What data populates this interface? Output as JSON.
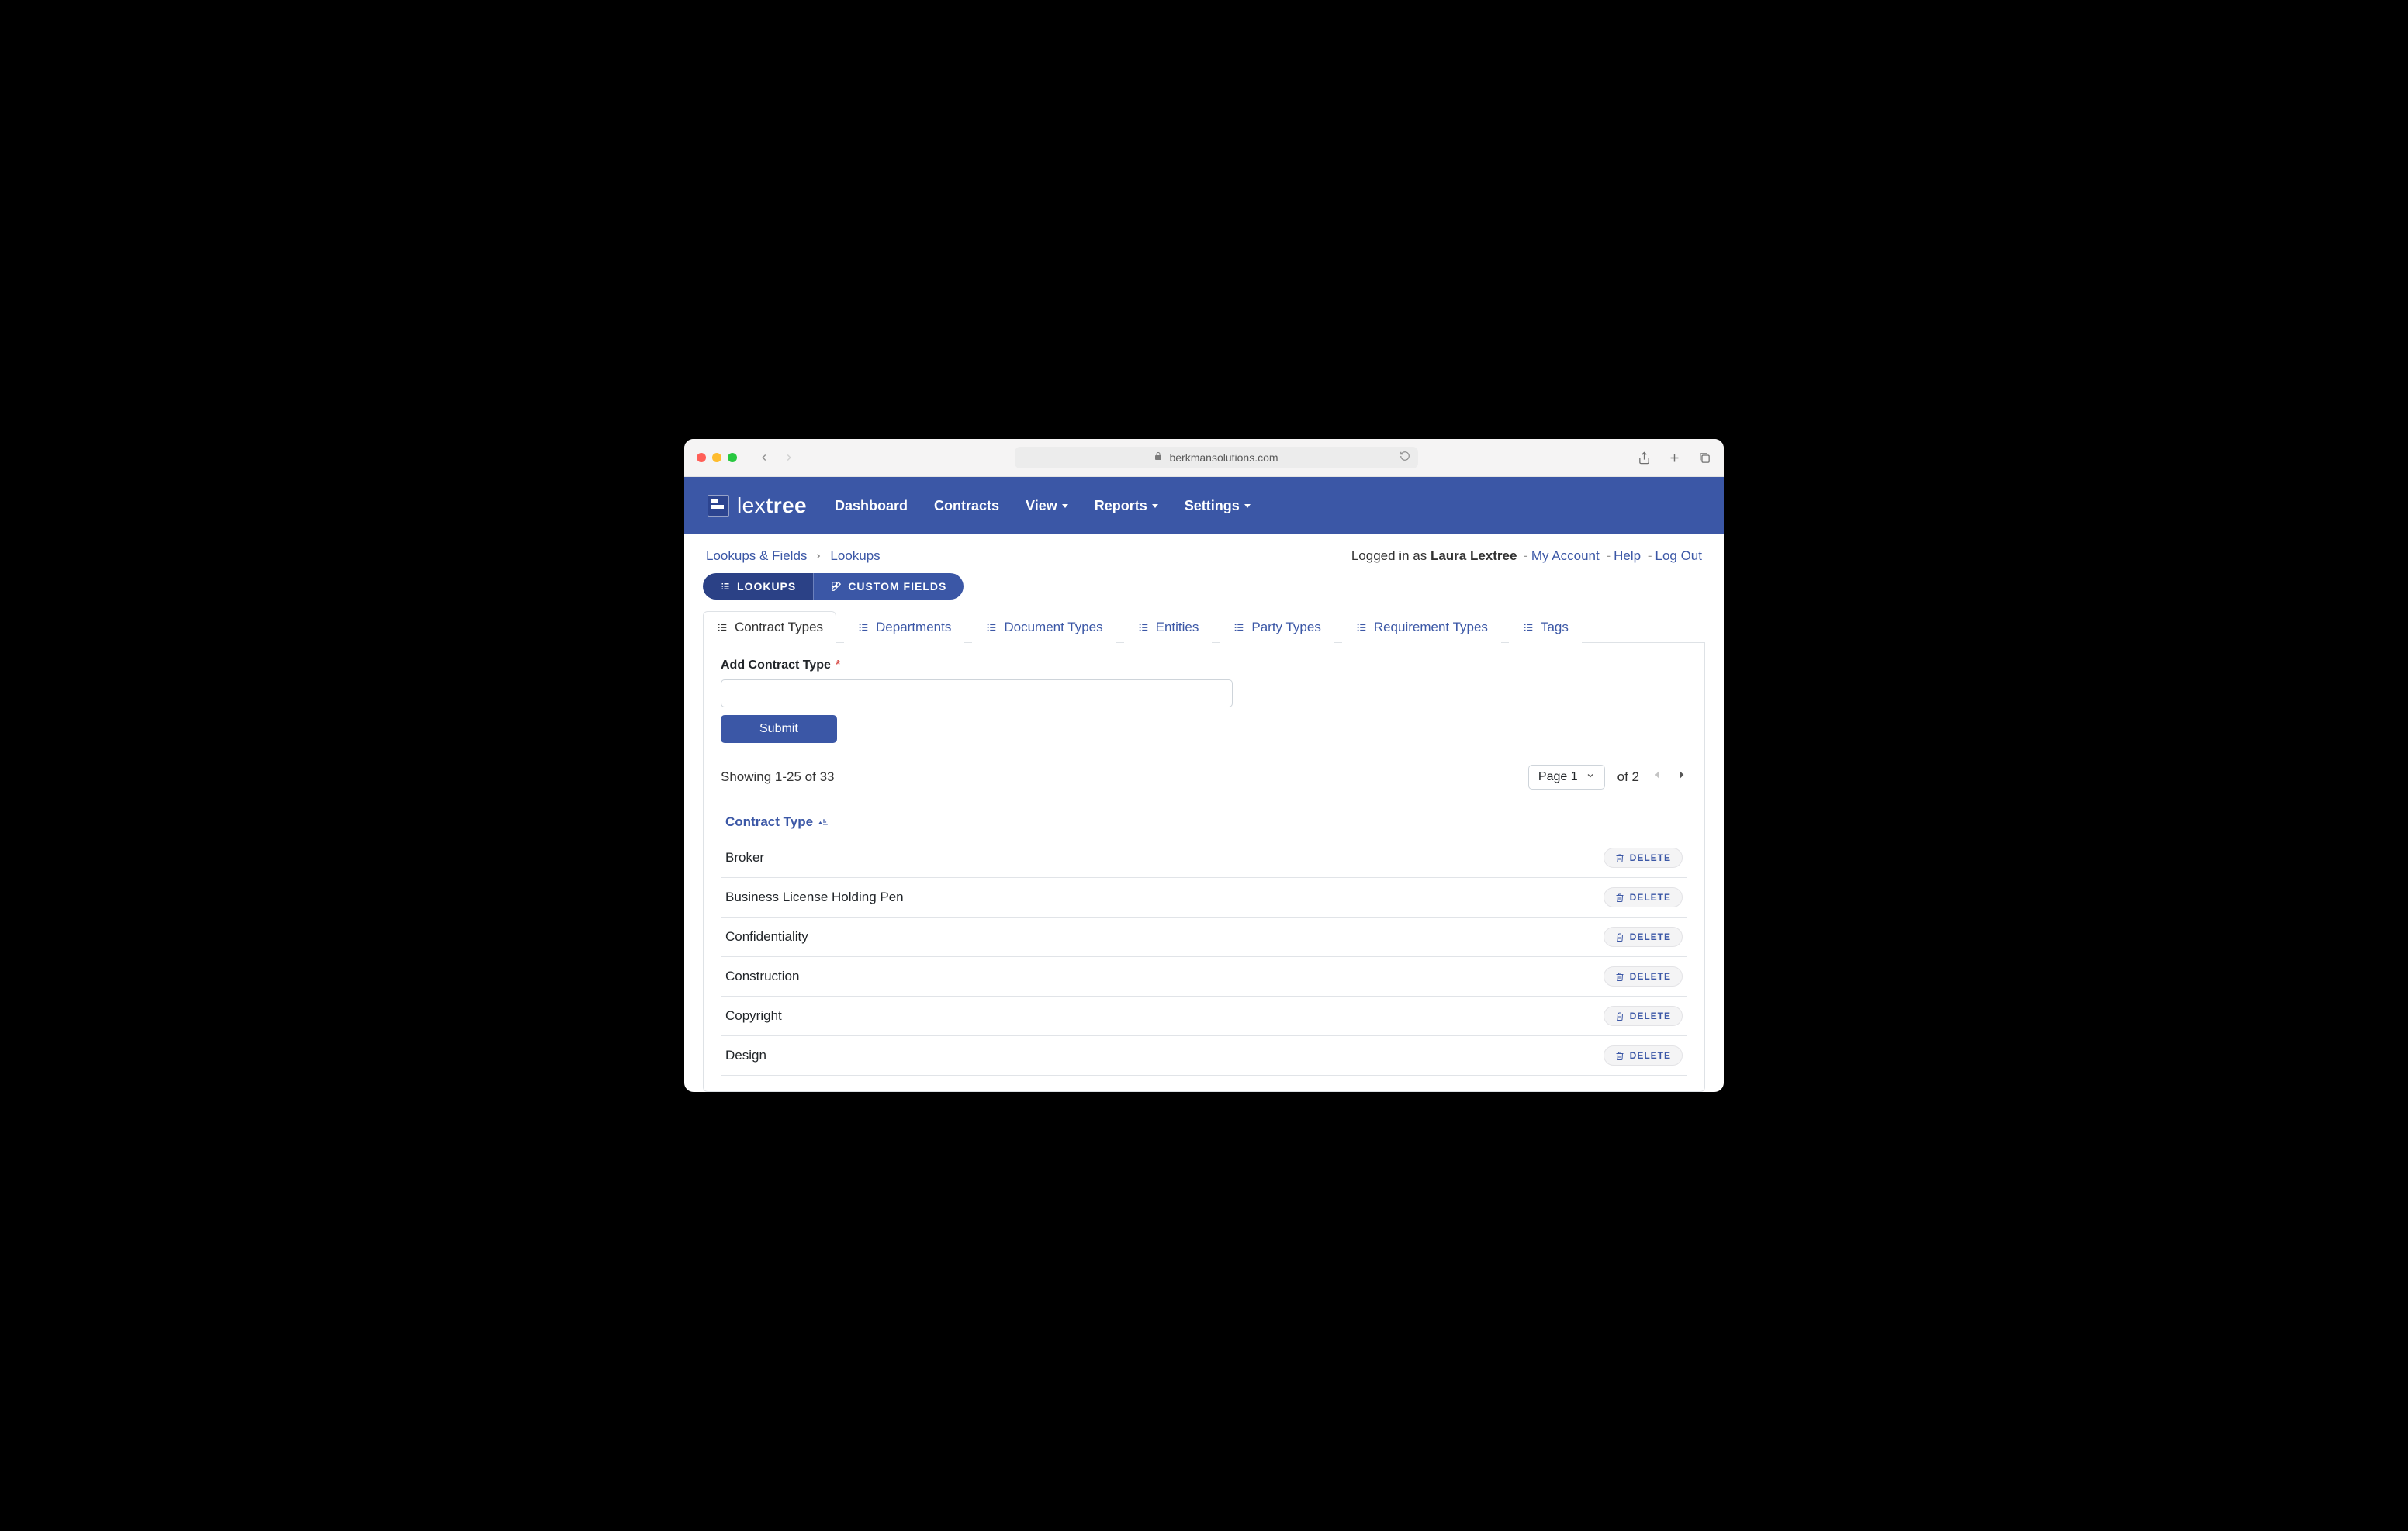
{
  "browser": {
    "domain": "berkmansolutions.com"
  },
  "brand": {
    "thin": "lex",
    "bold": "tree"
  },
  "nav": {
    "dashboard": "Dashboard",
    "contracts": "Contracts",
    "view": "View",
    "reports": "Reports",
    "settings": "Settings"
  },
  "breadcrumb": {
    "root": "Lookups & Fields",
    "current": "Lookups"
  },
  "user": {
    "logged_in_as": "Logged in as ",
    "name": "Laura Lextree",
    "my_account": "My Account",
    "help": "Help",
    "log_out": "Log Out"
  },
  "subtabs": {
    "lookups": "Lookups",
    "custom_fields": "Custom Fields"
  },
  "lookup_tabs": [
    "Contract Types",
    "Departments",
    "Document Types",
    "Entities",
    "Party Types",
    "Requirement Types",
    "Tags"
  ],
  "form": {
    "label": "Add Contract Type",
    "submit": "Submit"
  },
  "list": {
    "showing": "Showing 1-25 of 33",
    "page_label": "Page 1",
    "of_label": "of 2",
    "column": "Contract Type",
    "delete": "DELETE",
    "rows": [
      "Broker",
      "Business License Holding Pen",
      "Confidentiality",
      "Construction",
      "Copyright",
      "Design"
    ]
  }
}
